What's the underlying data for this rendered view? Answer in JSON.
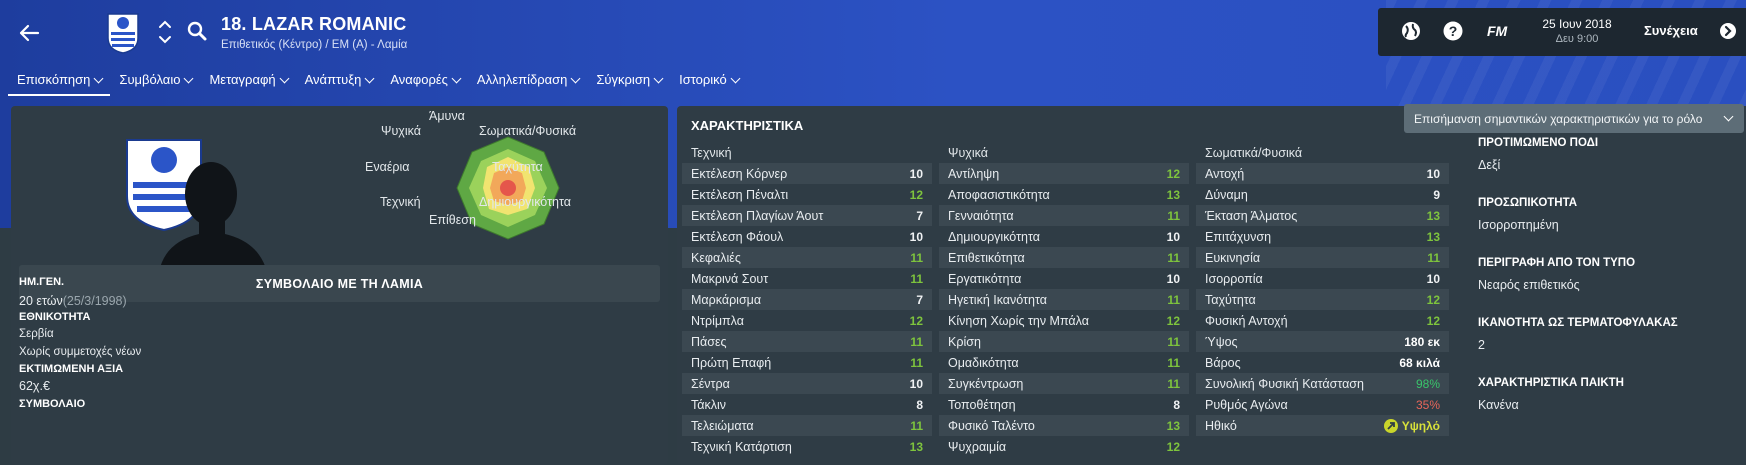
{
  "header": {
    "player_title": "18. LAZAR ROMANIC",
    "player_subtitle": "Επιθετικός (Κέντρο) / ΕΜ (Α) - Λαμία"
  },
  "topbar": {
    "date": "25 Ιουν 2018",
    "time": "Δευ 9:00",
    "fm_label": "FM",
    "continue_label": "Συνέχεια"
  },
  "tabs": [
    {
      "label": "Επισκόπηση"
    },
    {
      "label": "Συμβόλαιο"
    },
    {
      "label": "Μεταγραφή"
    },
    {
      "label": "Ανάπτυξη"
    },
    {
      "label": "Αναφορές"
    },
    {
      "label": "Αλληλεπίδραση"
    },
    {
      "label": "Σύγκριση"
    },
    {
      "label": "Ιστορικό"
    }
  ],
  "radar": {
    "labels": {
      "top": "Άμυνα",
      "top_left": "Ψυχικά",
      "top_right": "Σωματικά/Φυσικά",
      "left": "Εναέρια",
      "right": "Ταχύτητα",
      "bottom_left": "Τεχνική",
      "bottom_right": "Δημιουργικότητα",
      "bottom": "Επίθεση"
    }
  },
  "overview": {
    "contract_heading": "ΣΥΜΒΟΛΑΙΟ ΜΕ ΤΗ ΛΑΜΙΑ",
    "dob_label": "ΗΜ.ΓΕΝ.",
    "age": "20 ετών",
    "dob": "(25/3/1998)",
    "nationality_label": "ΕΘΝΙΚΟΤΗΤΑ",
    "nationality": "Σερβία",
    "youth_caps": "Χωρίς συμμετοχές νέων",
    "value_label": "ΕΚΤΙΜΩΜΕΝΗ ΑΞΙΑ",
    "value": "62χ.€",
    "contract_label": "ΣΥΜΒΟΛΑΙΟ"
  },
  "attributes": {
    "title": "ΧΑΡΑΚΤΗΡΙΣΤΙΚΑ",
    "highlight_select": "Επισήμανση σημαντικών χαρακτηριστικών για το ρόλο",
    "technical_header": "Τεχνική",
    "mental_header": "Ψυχικά",
    "physical_header": "Σωματικά/Φυσικά",
    "technical": [
      {
        "name": "Εκτέλεση Κόρνερ",
        "value": "10",
        "hl": false
      },
      {
        "name": "Εκτέλεση Πέναλτι",
        "value": "12",
        "hl": true
      },
      {
        "name": "Εκτέλεση Πλαγίων Άουτ",
        "value": "7",
        "hl": false
      },
      {
        "name": "Εκτέλεση Φάουλ",
        "value": "10",
        "hl": false
      },
      {
        "name": "Κεφαλιές",
        "value": "11",
        "hl": true
      },
      {
        "name": "Μακρινά Σουτ",
        "value": "11",
        "hl": true
      },
      {
        "name": "Μαρκάρισμα",
        "value": "7",
        "hl": false
      },
      {
        "name": "Ντρίμπλα",
        "value": "12",
        "hl": true
      },
      {
        "name": "Πάσες",
        "value": "11",
        "hl": true
      },
      {
        "name": "Πρώτη Επαφή",
        "value": "11",
        "hl": true
      },
      {
        "name": "Σέντρα",
        "value": "10",
        "hl": false
      },
      {
        "name": "Τάκλιν",
        "value": "8",
        "hl": false
      },
      {
        "name": "Τελειώματα",
        "value": "11",
        "hl": true
      },
      {
        "name": "Τεχνική Κατάρτιση",
        "value": "13",
        "hl": true
      }
    ],
    "mental": [
      {
        "name": "Αντίληψη",
        "value": "12",
        "hl": true
      },
      {
        "name": "Αποφασιστικότητα",
        "value": "13",
        "hl": true
      },
      {
        "name": "Γενναιότητα",
        "value": "11",
        "hl": true
      },
      {
        "name": "Δημιουργικότητα",
        "value": "10",
        "hl": false
      },
      {
        "name": "Επιθετικότητα",
        "value": "11",
        "hl": true
      },
      {
        "name": "Εργατικότητα",
        "value": "10",
        "hl": false
      },
      {
        "name": "Ηγετική Ικανότητα",
        "value": "11",
        "hl": true
      },
      {
        "name": "Κίνηση Χωρίς την Μπάλα",
        "value": "12",
        "hl": true
      },
      {
        "name": "Κρίση",
        "value": "11",
        "hl": true
      },
      {
        "name": "Ομαδικότητα",
        "value": "11",
        "hl": true
      },
      {
        "name": "Συγκέντρωση",
        "value": "11",
        "hl": true
      },
      {
        "name": "Τοποθέτηση",
        "value": "8",
        "hl": false
      },
      {
        "name": "Φυσικό Ταλέντο",
        "value": "13",
        "hl": true
      },
      {
        "name": "Ψυχραιμία",
        "value": "12",
        "hl": true
      }
    ],
    "physical": [
      {
        "name": "Αντοχή",
        "value": "10",
        "hl": false
      },
      {
        "name": "Δύναμη",
        "value": "9",
        "hl": false
      },
      {
        "name": "Έκταση Άλματος",
        "value": "13",
        "hl": true
      },
      {
        "name": "Επιτάχυνση",
        "value": "13",
        "hl": true
      },
      {
        "name": "Ευκινησία",
        "value": "11",
        "hl": true
      },
      {
        "name": "Ισορροπία",
        "value": "10",
        "hl": false
      },
      {
        "name": "Ταχύτητα",
        "value": "12",
        "hl": true
      },
      {
        "name": "Φυσική Αντοχή",
        "value": "12",
        "hl": true
      }
    ],
    "extra": [
      {
        "name": "Ύψος",
        "value": "180 εκ",
        "cls": "bold-white"
      },
      {
        "name": "Βάρος",
        "value": "68 κιλά",
        "cls": "bold-white"
      },
      {
        "name": "Συνολική Φυσική Κατάσταση",
        "value": "98%",
        "cls": "pct-green"
      },
      {
        "name": "Ρυθμός Αγώνα",
        "value": "35%",
        "cls": "pct-red"
      }
    ],
    "morale_label": "Ηθικό",
    "morale_value": "Υψηλό"
  },
  "side": [
    {
      "label": "ΠΡΟΤΙΜΩΜΕΝΟ ΠΟΔΙ",
      "value": "Δεξί"
    },
    {
      "label": "ΠΡΟΣΩΠΙΚΟΤΗΤΑ",
      "value": "Ισορροπημένη"
    },
    {
      "label": "ΠΕΡΙΓΡΑΦΗ ΑΠΟ ΤΟΝ ΤΥΠΟ",
      "value": "Νεαρός επιθετικός"
    },
    {
      "label": "ΙΚΑΝΟΤΗΤΑ ΩΣ ΤΕΡΜΑΤΟΦΥΛΑΚΑΣ",
      "value": "2"
    },
    {
      "label": "ΧΑΡΑΚΤΗΡΙΣΤΙΚΑ ΠΑΙΚΤΗ",
      "value": "Κανένα"
    }
  ],
  "colors": {
    "header_blue": "#2c52c4",
    "panel": "#2f3c45",
    "highlight_green": "#7ec43d"
  }
}
